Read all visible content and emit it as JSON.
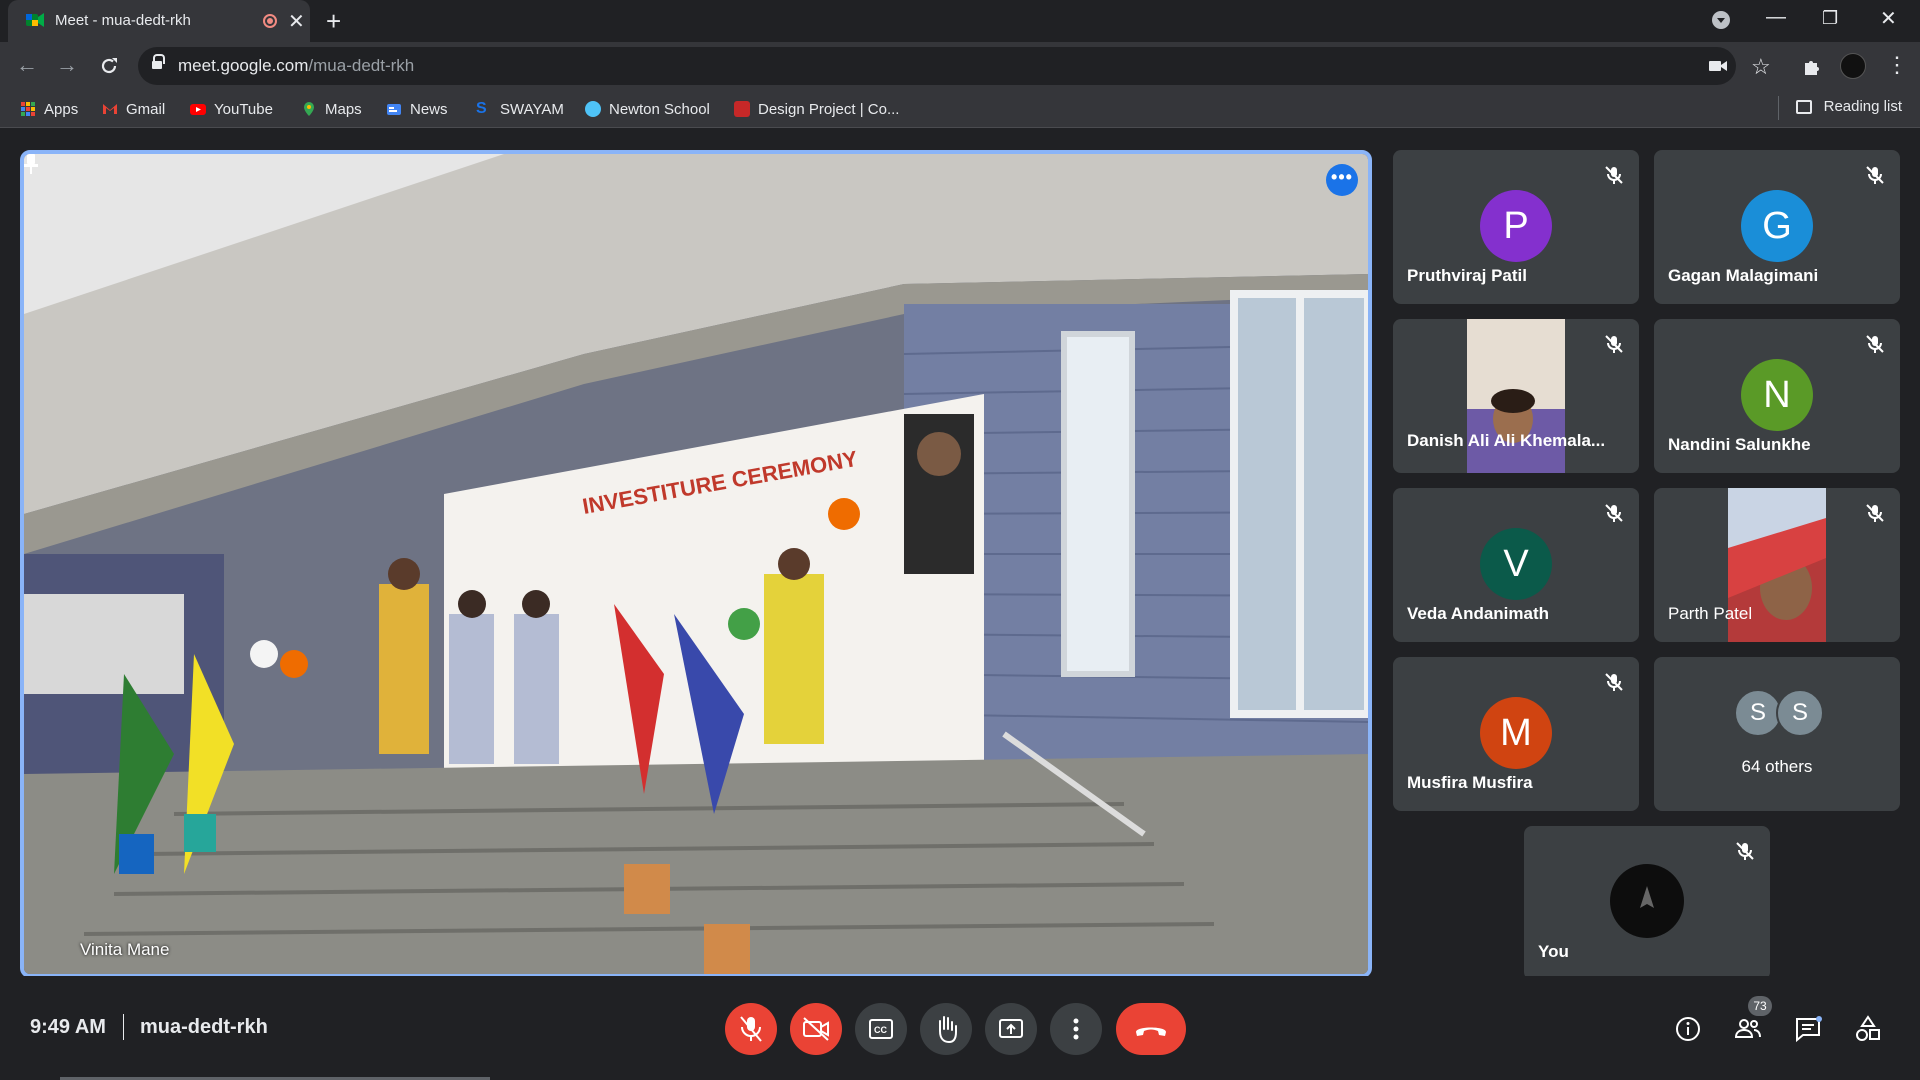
{
  "browser": {
    "tab_title": "Meet - mua-dedt-rkh",
    "new_tab_symbol": "+",
    "url_host": "meet.google.com",
    "url_path": "/mua-dedt-rkh",
    "window_controls": [
      "minimize-icon",
      "restore-icon",
      "close-icon"
    ]
  },
  "bookmarks": {
    "items": [
      {
        "label": "Apps",
        "icon": "apps-grid-icon",
        "color": "#4285f4"
      },
      {
        "label": "Gmail",
        "icon": "gmail-icon",
        "color": "#ea4335"
      },
      {
        "label": "YouTube",
        "icon": "youtube-icon",
        "color": "#ff0000"
      },
      {
        "label": "Maps",
        "icon": "maps-icon",
        "color": "#34a853"
      },
      {
        "label": "News",
        "icon": "news-icon",
        "color": "#4285f4"
      },
      {
        "label": "SWAYAM",
        "icon": "swayam-icon",
        "color": "#1a73e8"
      },
      {
        "label": "Newton School",
        "icon": "newton-school-icon",
        "color": "#4fc3f7"
      },
      {
        "label": "Design Project | Co...",
        "icon": "mit-icon",
        "color": "#c62828"
      }
    ],
    "reading_list": "Reading list"
  },
  "meet": {
    "main_speaker": "Vinita Mane",
    "more_options_symbol": "•••",
    "accent": "#8ab4f8",
    "participants": [
      {
        "name": "Pruthviraj Patil",
        "initial": "P",
        "color": "#8430ce",
        "muted": true
      },
      {
        "name": "Gagan Malagimani",
        "initial": "G",
        "color": "#1a8ed8",
        "muted": true
      },
      {
        "name": "Danish Ali Ali Khemala...",
        "initial": "",
        "color": "",
        "muted": true,
        "video": true
      },
      {
        "name": "Nandini Salunkhe",
        "initial": "N",
        "color": "#5a9a27",
        "muted": true
      },
      {
        "name": "Veda Andanimath",
        "initial": "V",
        "color": "#0b5a4a",
        "muted": true
      },
      {
        "name": "Parth Patel",
        "initial": "",
        "color": "",
        "muted": true,
        "video": true
      },
      {
        "name": "Musfira Musfira",
        "initial": "M",
        "color": "#d04411",
        "muted": true
      }
    ],
    "others": {
      "label": "64 others",
      "initials": [
        "S",
        "S"
      ],
      "color": "#7b8b94"
    },
    "self": {
      "name": "You",
      "muted": true
    },
    "meeting_time": "9:49 AM",
    "meeting_code": "mua-dedt-rkh",
    "participant_count": "73",
    "controls": {
      "mic": "mic-off-icon",
      "camera": "camera-off-icon",
      "captions": "captions-icon",
      "hand": "raise-hand-icon",
      "present": "present-icon",
      "more": "more-vert-icon",
      "end": "end-call-icon"
    }
  }
}
